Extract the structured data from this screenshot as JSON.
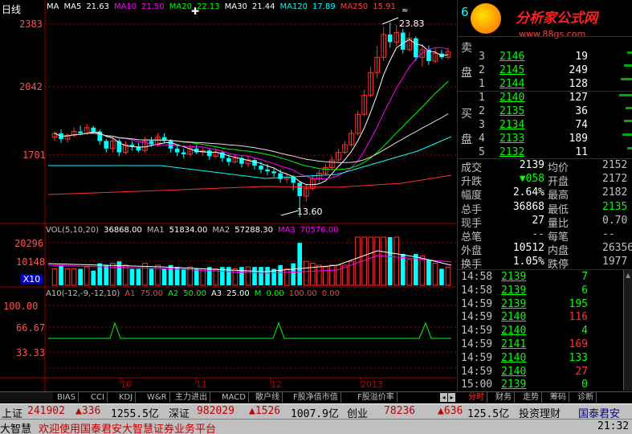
{
  "app": {
    "period_label": "日线",
    "watermark_main": "分析家公式网",
    "watermark_url": "www.88gs.com"
  },
  "main_chart": {
    "ma_legend": [
      {
        "label": "MA",
        "color": "#ffffff"
      },
      {
        "label": "MA5",
        "color": "#ffffff"
      },
      {
        "label": "21.63",
        "color": "#ffffff"
      },
      {
        "label": "MA10",
        "color": "#ff00ff"
      },
      {
        "label": "21.50",
        "color": "#ff00ff"
      },
      {
        "label": "MA20",
        "color": "#00ff00"
      },
      {
        "label": "22.13",
        "color": "#00ff00"
      },
      {
        "label": "MA30",
        "color": "#ffffff"
      },
      {
        "label": "21.44",
        "color": "#ffffff"
      },
      {
        "label": "MA120",
        "color": "#00ffff"
      },
      {
        "label": "17.89",
        "color": "#00ffff"
      },
      {
        "label": "MA250",
        "color": "#ff4040"
      },
      {
        "label": "15.91",
        "color": "#ff4040"
      }
    ],
    "price_axis": [
      "2383",
      "2042",
      "1701"
    ],
    "high_marker": "23.83",
    "low_marker": "13.60",
    "volume_legend": [
      {
        "label": "VOL(5,10,20)",
        "color": "#c0c0c0"
      },
      {
        "label": "36868.00",
        "color": "#ffffff"
      },
      {
        "label": "MA1",
        "color": "#c0c0c0"
      },
      {
        "label": "51834.00",
        "color": "#ffffff"
      },
      {
        "label": "MA2",
        "color": "#c0c0c0"
      },
      {
        "label": "57288.30",
        "color": "#ffffff"
      },
      {
        "label": "MA3",
        "color": "#ff00ff"
      },
      {
        "label": "70576.00",
        "color": "#ff00ff"
      }
    ],
    "volume_axis": [
      "20296",
      "10148"
    ],
    "volume_multiplier": "X10",
    "indicator_legend": [
      {
        "label": "A10(-12,-9,-12,10)",
        "color": "#c0c0c0"
      },
      {
        "label": "A1",
        "color": "#ff4040"
      },
      {
        "label": "75.00",
        "color": "#ff4040"
      },
      {
        "label": "A2",
        "color": "#00ff00"
      },
      {
        "label": "50.00",
        "color": "#00ff00"
      },
      {
        "label": "A3",
        "color": "#ffffff"
      },
      {
        "label": "25.00",
        "color": "#ffffff"
      },
      {
        "label": "M",
        "color": "#00ff00"
      },
      {
        "label": "0.00",
        "color": "#00ff00"
      },
      {
        "label": "100.00",
        "color": "#ff4040"
      },
      {
        "label": "0.00",
        "color": "#ff4040"
      }
    ],
    "indicator_axis": [
      "100.00",
      "66.67",
      "33.33"
    ],
    "date_axis": [
      "10",
      "11",
      "12",
      "2013"
    ]
  },
  "chart_data": {
    "type": "candlestick",
    "price_scale": {
      "min": 1360,
      "max": 2383
    },
    "candles": [
      [
        1780,
        1800,
        1760,
        1810
      ],
      [
        1800,
        1770,
        1750,
        1820
      ],
      [
        1770,
        1790,
        1750,
        1800
      ],
      [
        1790,
        1810,
        1780,
        1830
      ],
      [
        1810,
        1800,
        1790,
        1840
      ],
      [
        1800,
        1830,
        1790,
        1850
      ],
      [
        1830,
        1810,
        1800,
        1840
      ],
      [
        1810,
        1760,
        1740,
        1820
      ],
      [
        1760,
        1720,
        1700,
        1770
      ],
      [
        1720,
        1760,
        1700,
        1780
      ],
      [
        1760,
        1700,
        1680,
        1770
      ],
      [
        1700,
        1740,
        1690,
        1760
      ],
      [
        1740,
        1730,
        1710,
        1760
      ],
      [
        1730,
        1710,
        1700,
        1750
      ],
      [
        1710,
        1760,
        1700,
        1780
      ],
      [
        1760,
        1740,
        1730,
        1780
      ],
      [
        1740,
        1780,
        1730,
        1800
      ],
      [
        1780,
        1760,
        1750,
        1800
      ],
      [
        1760,
        1720,
        1700,
        1770
      ],
      [
        1720,
        1700,
        1680,
        1740
      ],
      [
        1700,
        1690,
        1670,
        1720
      ],
      [
        1690,
        1720,
        1680,
        1740
      ],
      [
        1720,
        1700,
        1690,
        1740
      ],
      [
        1700,
        1710,
        1680,
        1730
      ],
      [
        1710,
        1680,
        1660,
        1720
      ],
      [
        1680,
        1700,
        1670,
        1720
      ],
      [
        1700,
        1670,
        1650,
        1710
      ],
      [
        1670,
        1650,
        1630,
        1690
      ],
      [
        1650,
        1670,
        1640,
        1690
      ],
      [
        1670,
        1640,
        1620,
        1680
      ],
      [
        1640,
        1660,
        1620,
        1680
      ],
      [
        1660,
        1630,
        1610,
        1670
      ],
      [
        1630,
        1610,
        1590,
        1650
      ],
      [
        1610,
        1600,
        1580,
        1640
      ],
      [
        1600,
        1590,
        1570,
        1620
      ],
      [
        1590,
        1560,
        1540,
        1610
      ],
      [
        1560,
        1570,
        1540,
        1590
      ],
      [
        1570,
        1540,
        1500,
        1580
      ],
      [
        1540,
        1470,
        1360,
        1550
      ],
      [
        1470,
        1510,
        1440,
        1530
      ],
      [
        1510,
        1560,
        1500,
        1580
      ],
      [
        1560,
        1590,
        1540,
        1610
      ],
      [
        1590,
        1620,
        1580,
        1640
      ],
      [
        1620,
        1660,
        1610,
        1680
      ],
      [
        1660,
        1700,
        1650,
        1720
      ],
      [
        1700,
        1740,
        1690,
        1760
      ],
      [
        1740,
        1800,
        1730,
        1820
      ],
      [
        1800,
        1900,
        1790,
        1920
      ],
      [
        1900,
        2000,
        1890,
        2030
      ],
      [
        2000,
        2120,
        1990,
        2150
      ],
      [
        2120,
        2200,
        2090,
        2260
      ],
      [
        2200,
        2320,
        2180,
        2360
      ],
      [
        2320,
        2280,
        2250,
        2383
      ],
      [
        2280,
        2330,
        2260,
        2370
      ],
      [
        2330,
        2240,
        2220,
        2350
      ],
      [
        2240,
        2300,
        2230,
        2330
      ],
      [
        2300,
        2200,
        2180,
        2310
      ],
      [
        2200,
        2240,
        2150,
        2270
      ],
      [
        2240,
        2180,
        2160,
        2260
      ],
      [
        2180,
        2220,
        2170,
        2250
      ],
      [
        2220,
        2200,
        2190,
        2240
      ],
      [
        2200,
        2230,
        2190,
        2250
      ]
    ]
  },
  "quote_panel": {
    "code_digit": "6",
    "sell_label_1": "卖",
    "sell_label_2": "盘",
    "buy_label_1": "买",
    "buy_label_2": "盘",
    "sell_rows": [
      {
        "level": "3",
        "price": "2146",
        "vol": "19"
      },
      {
        "level": "2",
        "price": "2145",
        "vol": "249"
      },
      {
        "level": "1",
        "price": "2144",
        "vol": "128"
      }
    ],
    "buy_rows": [
      {
        "level": "1",
        "price": "2140",
        "vol": "127"
      },
      {
        "level": "2",
        "price": "2135",
        "vol": "36"
      },
      {
        "level": "3",
        "price": "2134",
        "vol": "74"
      },
      {
        "level": "4",
        "price": "2133",
        "vol": "189"
      },
      {
        "level": "5",
        "price": "2132",
        "vol": "11"
      }
    ],
    "stats": [
      {
        "k1": "成交",
        "v1": "2139",
        "k2": "均价",
        "v2": "2152"
      },
      {
        "k1": "升跌",
        "v1": "▼058",
        "k2": "开盘",
        "v2": "2172"
      },
      {
        "k1": "幅度",
        "v1": "2.64%",
        "k2": "最高",
        "v2": "2182"
      },
      {
        "k1": "总手",
        "v1": "36868",
        "k2": "最低",
        "v2": "2135"
      },
      {
        "k1": "现手",
        "v1": "27",
        "k2": "量比",
        "v2": "0.70"
      },
      {
        "k1": "总笔",
        "v1": "--",
        "k2": "每笔",
        "v2": "--"
      },
      {
        "k1": "外盘",
        "v1": "10512",
        "k2": "内盘",
        "v2": "26356"
      },
      {
        "k1": "换手",
        "v1": "1.05%",
        "k2": "跌停",
        "v2": "1977"
      }
    ],
    "ticks": [
      {
        "time": "14:58",
        "price": "2139",
        "vol": "7"
      },
      {
        "time": "14:58",
        "price": "2139",
        "vol": "6"
      },
      {
        "time": "14:59",
        "price": "2139",
        "vol": "195"
      },
      {
        "time": "14:59",
        "price": "2140",
        "vol": "116"
      },
      {
        "time": "14:59",
        "price": "2140",
        "vol": "4"
      },
      {
        "time": "14:59",
        "price": "2141",
        "vol": "169"
      },
      {
        "time": "14:59",
        "price": "2140",
        "vol": "133"
      },
      {
        "time": "14:59",
        "price": "2140",
        "vol": "27"
      },
      {
        "time": "15:00",
        "price": "2139",
        "vol": "0"
      }
    ],
    "tabs": [
      "分时",
      "财务",
      "走势",
      "筹码",
      "诊断"
    ]
  },
  "indicator_tabs": [
    "BIAS",
    "CCI",
    "KDJ",
    "W&R",
    "主力进出",
    "MACD",
    "散户线",
    "F股净值市值",
    "F股溢价率"
  ],
  "status": {
    "sh_label": "上证",
    "sh_value": "241902",
    "sh_change": "▲336",
    "sh_amount": "1255.5亿",
    "sz_label": "深证",
    "sz_value": "982029",
    "sz_change": "▲1526",
    "sz_amount": "1007.9亿",
    "cy_label": "创业",
    "cy_value": "78236",
    "cy_change": "▲636",
    "cy_amount": "125.5亿",
    "btn1": "投资理财",
    "btn2": "国泰君安",
    "brand": "大智慧",
    "welcome": "欢迎使用国泰君安大智慧证券业务平台",
    "clock": "21:32"
  }
}
